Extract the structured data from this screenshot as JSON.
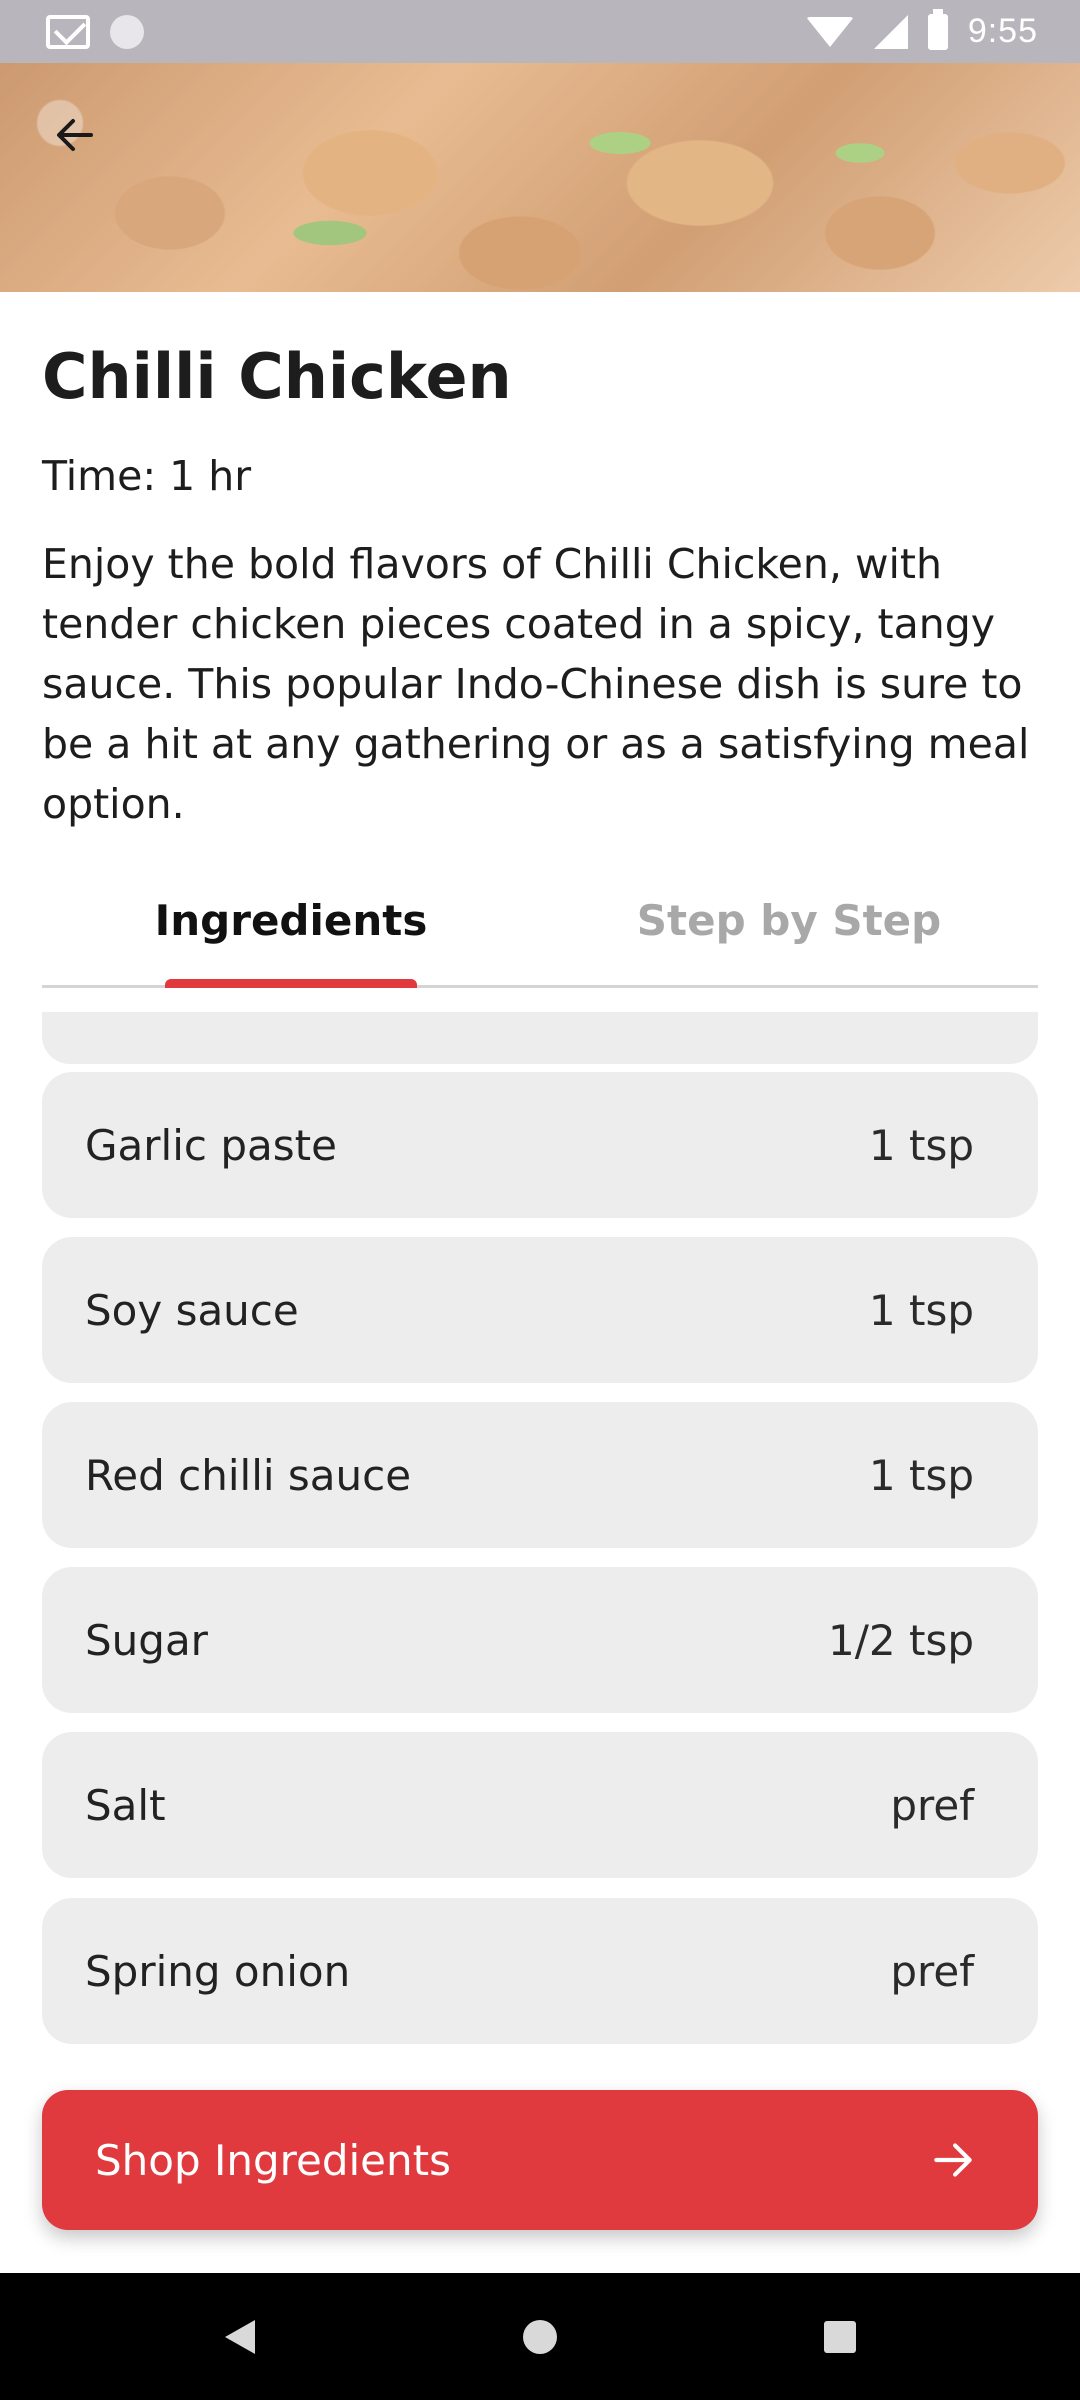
{
  "status_bar": {
    "time": "9:55",
    "icons": [
      "gmail-icon",
      "notification-dot-icon",
      "wifi-icon",
      "signal-icon",
      "battery-icon"
    ]
  },
  "hero": {
    "image": "chilli-chicken-photo",
    "back_icon": "arrow-left-icon"
  },
  "recipe": {
    "title": "Chilli Chicken",
    "time": "Time: 1 hr",
    "description": "Enjoy the bold flavors of Chilli Chicken, with tender chicken pieces coated in a spicy, tangy sauce. This popular Indo-Chinese dish is sure to be a hit at any gathering or as a satisfying meal option."
  },
  "tabs": [
    {
      "label": "Ingredients",
      "active": true
    },
    {
      "label": "Step by Step",
      "active": false
    }
  ],
  "ingredients": [
    {
      "name": "Garlic paste",
      "quantity": "1 tsp"
    },
    {
      "name": "Soy sauce",
      "quantity": "1 tsp"
    },
    {
      "name": "Red chilli sauce",
      "quantity": "1 tsp"
    },
    {
      "name": "Sugar",
      "quantity": "1/2 tsp"
    },
    {
      "name": "Salt",
      "quantity": "pref"
    },
    {
      "name": "Spring onion",
      "quantity": "pref"
    }
  ],
  "shop_button": {
    "label": "Shop Ingredients",
    "icon": "arrow-right-icon"
  },
  "colors": {
    "accent": "#e03a3e",
    "row_background": "#ededed",
    "inactive_tab": "#a8a8a8"
  },
  "nav_bar": {
    "icons": [
      "back-triangle-icon",
      "home-circle-icon",
      "recents-square-icon"
    ]
  }
}
